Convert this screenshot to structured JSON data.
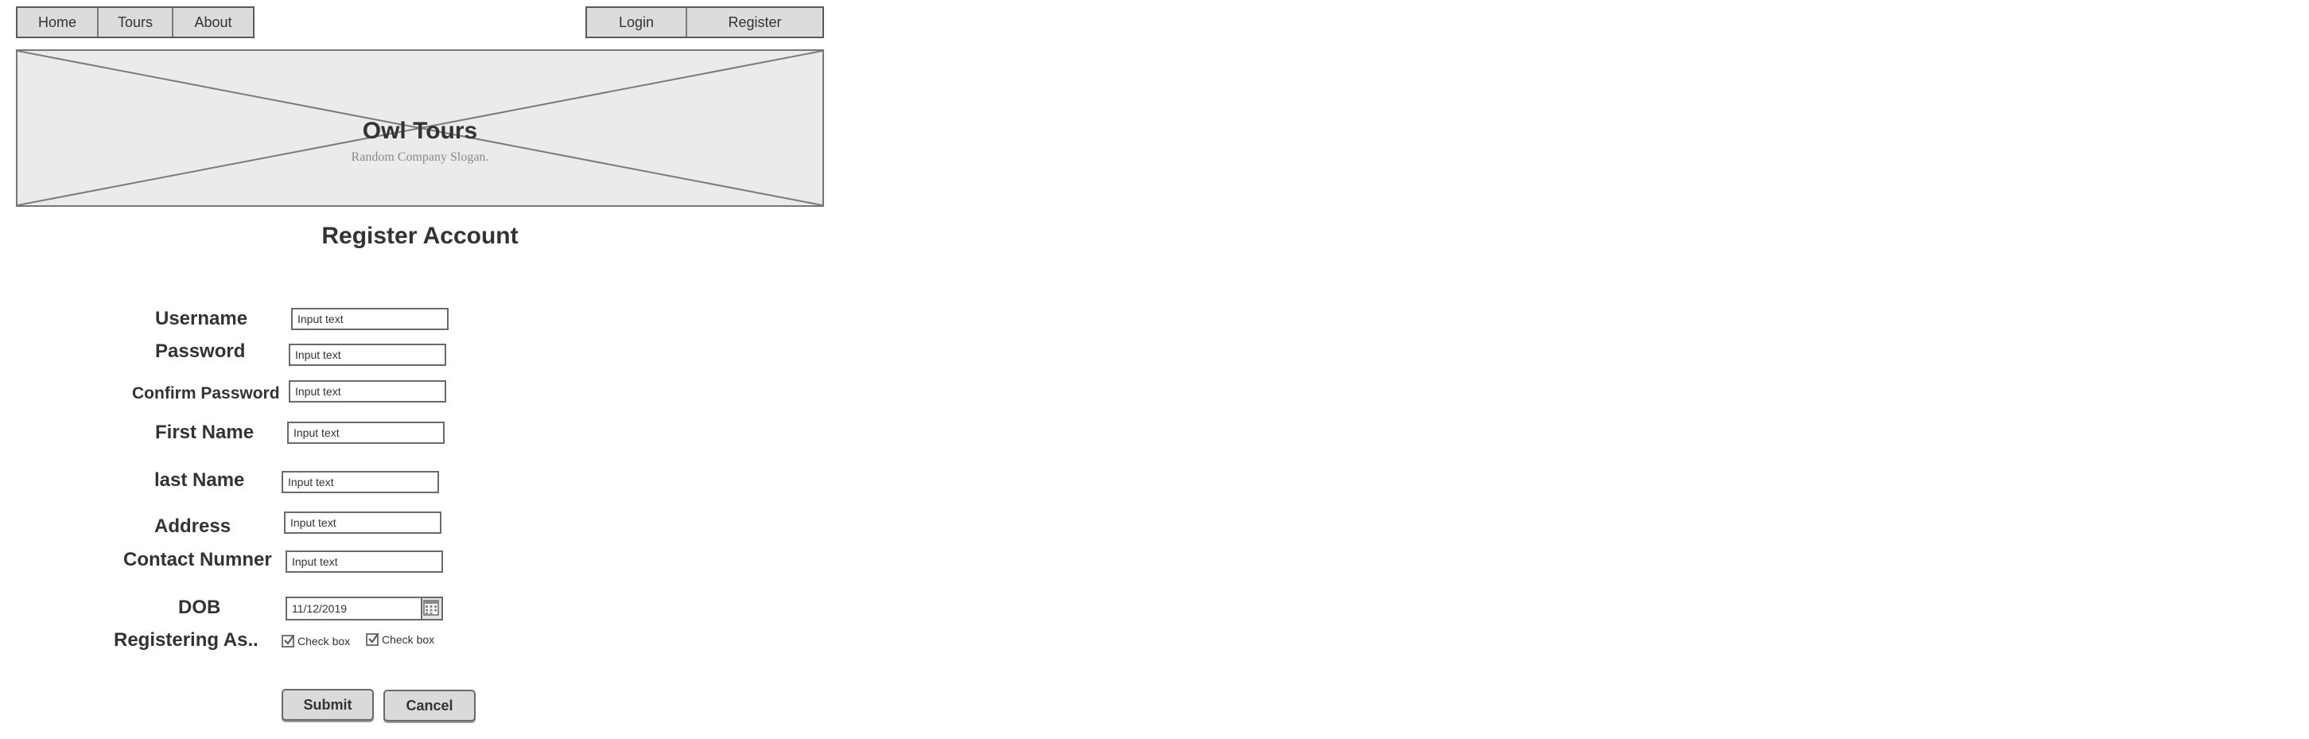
{
  "nav": {
    "left_items": [
      {
        "label": "Home"
      },
      {
        "label": "Tours"
      },
      {
        "label": "About"
      }
    ],
    "right_items": [
      {
        "label": "Login"
      },
      {
        "label": "Register"
      }
    ]
  },
  "banner": {
    "title": "Owl Tours",
    "slogan": "Random Company Slogan."
  },
  "page": {
    "title": "Register Account"
  },
  "form": {
    "fields": [
      {
        "label": "Username",
        "value": "Input text"
      },
      {
        "label": "Password",
        "value": "Input text"
      },
      {
        "label": "Confirm Password",
        "value": "Input text"
      },
      {
        "label": "First Name",
        "value": "Input text"
      },
      {
        "label": "last Name",
        "value": "Input text"
      },
      {
        "label": "Address",
        "value": "Input text"
      },
      {
        "label": "Contact Numner",
        "value": "Input text"
      }
    ],
    "dob": {
      "label": "DOB",
      "value": "11/12/2019",
      "icon": "calendar-icon"
    },
    "registering": {
      "label": "Registering As..",
      "options": [
        {
          "label": "Check box",
          "checked": true
        },
        {
          "label": "Check box",
          "checked": true
        }
      ]
    },
    "submit_label": "Submit",
    "cancel_label": "Cancel"
  }
}
